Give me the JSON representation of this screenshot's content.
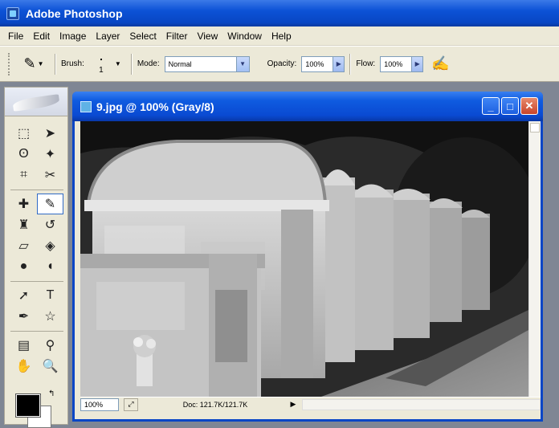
{
  "app": {
    "title": "Adobe Photoshop"
  },
  "menu": [
    "File",
    "Edit",
    "Image",
    "Layer",
    "Select",
    "Filter",
    "View",
    "Window",
    "Help"
  ],
  "options": {
    "brush_label": "Brush:",
    "brush_size": "1",
    "mode_label": "Mode:",
    "mode_value": "Normal",
    "opacity_label": "Opacity:",
    "opacity_value": "100%",
    "flow_label": "Flow:",
    "flow_value": "100%"
  },
  "document": {
    "title": "9.jpg @ 100% (Gray/8)",
    "zoom": "100%",
    "doc_info": "Doc: 121.7K/121.7K"
  },
  "colors": {
    "foreground": "#000000",
    "background": "#ffffff",
    "titlebar": "#0a4ad2"
  }
}
